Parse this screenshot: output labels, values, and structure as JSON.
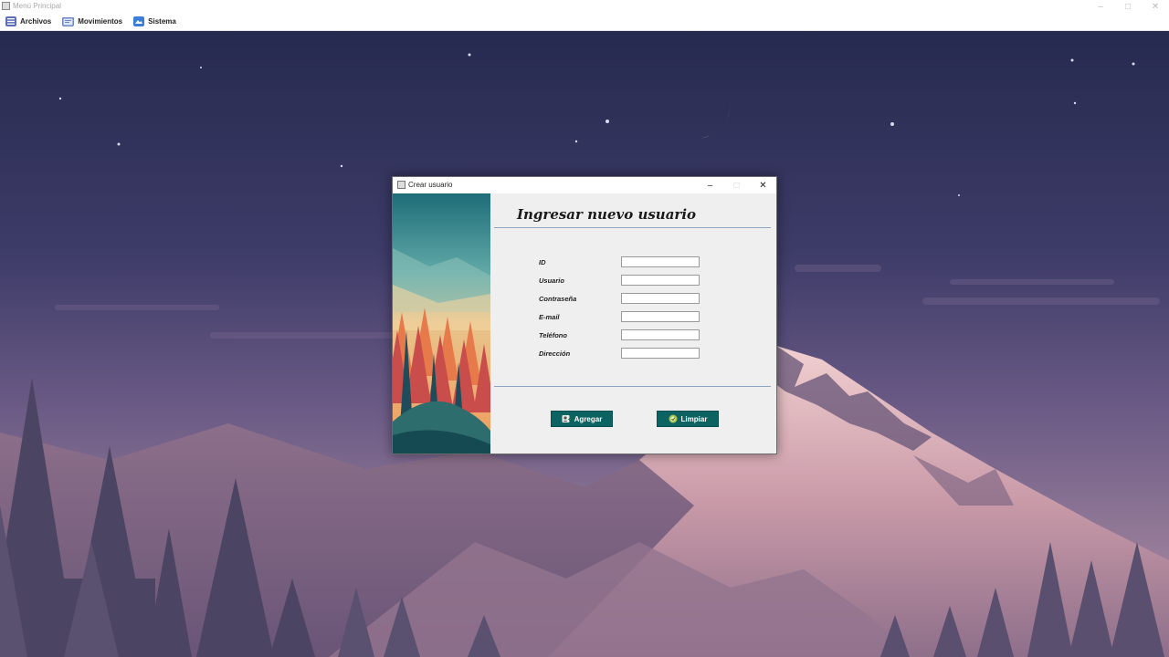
{
  "window": {
    "title": "Menú Principal",
    "minimize": "–",
    "maximize": "□",
    "close": "✕"
  },
  "menubar": [
    {
      "label": "Archivos",
      "icon": "list-icon",
      "color": "#5b6fb8"
    },
    {
      "label": "Movimientos",
      "icon": "folder-icon",
      "color": "#6d86c6"
    },
    {
      "label": "Sistema",
      "icon": "system-icon",
      "color": "#3a7fd5"
    }
  ],
  "dialog": {
    "title": "Crear usuario",
    "minimize": "–",
    "maximize": "□",
    "close": "✕",
    "heading": "Ingresar nuevo usuario",
    "fields": [
      {
        "label": "ID",
        "value": ""
      },
      {
        "label": "Usuario",
        "value": ""
      },
      {
        "label": "Contraseña",
        "value": ""
      },
      {
        "label": "E-mail",
        "value": ""
      },
      {
        "label": "Teléfono",
        "value": ""
      },
      {
        "label": "Dirección",
        "value": ""
      }
    ],
    "buttons": {
      "add": {
        "label": "Agregar",
        "icon": "user-add-icon"
      },
      "clear": {
        "label": "Limpiar",
        "icon": "clear-icon"
      }
    }
  },
  "colors": {
    "button_bg": "#0c6361",
    "divider": "#8aa6c2",
    "night_sky": "#2a2f55"
  }
}
